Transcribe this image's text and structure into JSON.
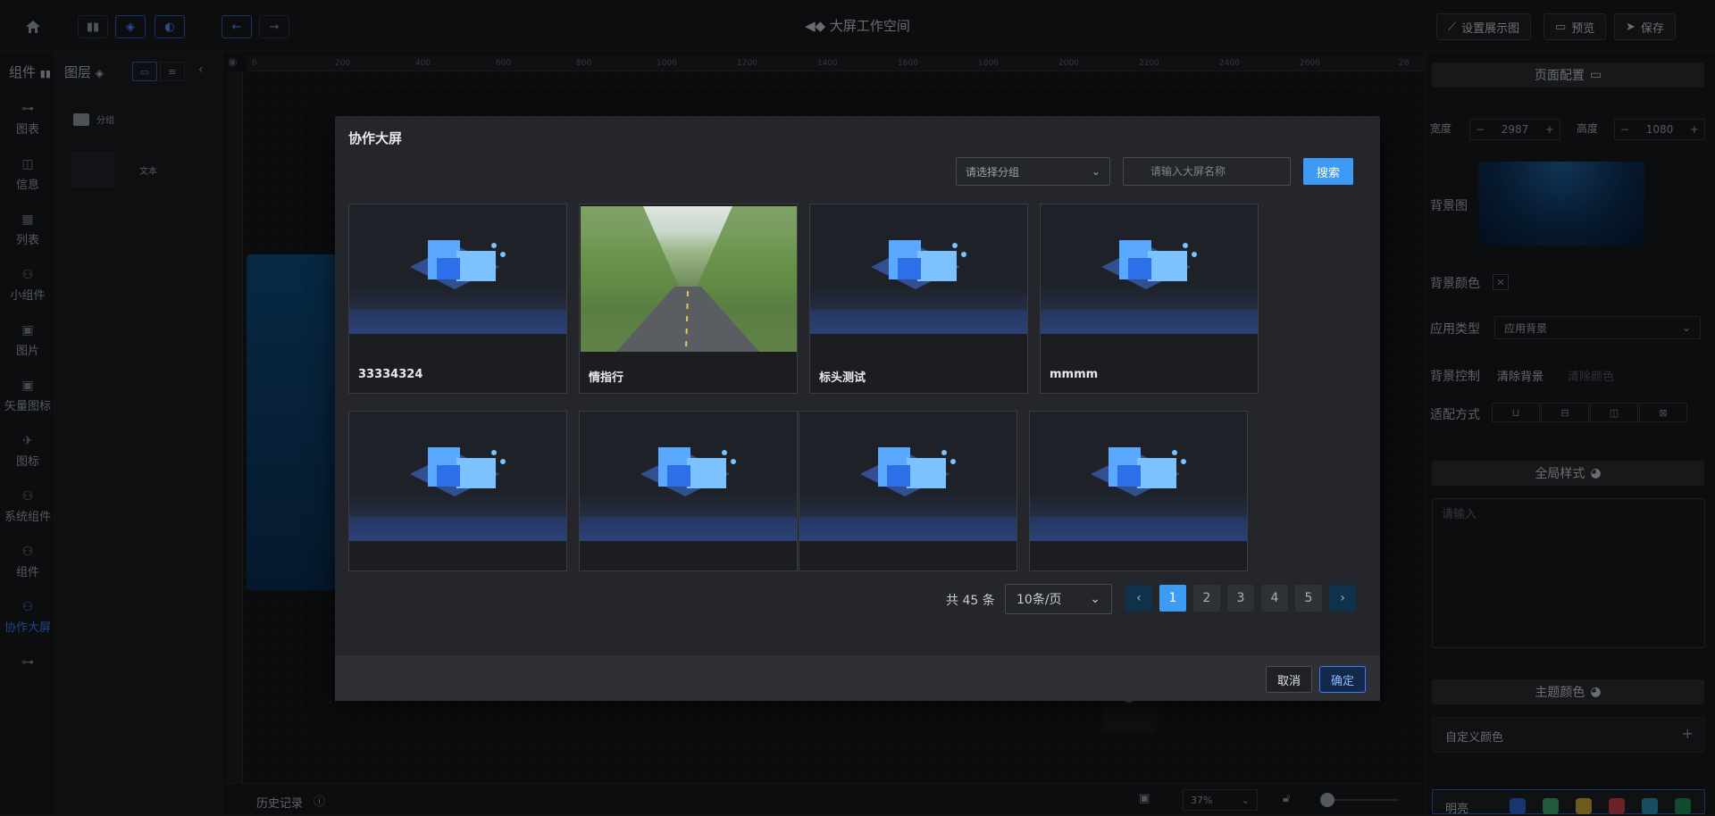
{
  "topbar": {
    "title": "大屏工作空间",
    "right_buttons": [
      "设置展示图",
      "预览",
      "保存"
    ]
  },
  "leftnav": {
    "header": "组件",
    "items": [
      {
        "label": "图表",
        "icon": "chart-icon"
      },
      {
        "label": "信息",
        "icon": "info-icon"
      },
      {
        "label": "列表",
        "icon": "table-icon"
      },
      {
        "label": "小组件",
        "icon": "widget-icon"
      },
      {
        "label": "图片",
        "icon": "image-icon"
      },
      {
        "label": "矢量图标",
        "icon": "vector-icon"
      },
      {
        "label": "图标",
        "icon": "plane-icon"
      },
      {
        "label": "系统组件",
        "icon": "system-icon"
      },
      {
        "label": "组件",
        "icon": "component-icon"
      },
      {
        "label": "协作大屏",
        "icon": "collab-icon",
        "active": true
      }
    ]
  },
  "layers": {
    "header": "图层",
    "items": [
      {
        "label": "分组"
      },
      {
        "label": "文本"
      }
    ]
  },
  "ruler": {
    "ticks": [
      "0",
      "200",
      "400",
      "600",
      "800",
      "1000",
      "1200",
      "1400",
      "1600",
      "1800",
      "2000",
      "2200",
      "2400",
      "2600",
      "28"
    ]
  },
  "rpanel": {
    "page_config": "页面配置",
    "width_label": "宽度",
    "width_value": "2987",
    "height_label": "高度",
    "height_value": "1080",
    "bg_image_label": "背景图",
    "bg_color_label": "背景颜色",
    "app_type_label": "应用类型",
    "app_type_value": "应用背景",
    "bg_control_label": "背景控制",
    "clear_bg": "清除背景",
    "clear_color": "清除颜色",
    "fit_label": "适配方式",
    "global_style": "全局样式",
    "textarea_placeholder": "请输入",
    "theme_color": "主题颜色",
    "custom_color": "自定义颜色",
    "bright_label": "明亮",
    "swatches": [
      "#2d63c8",
      "#3fa26a",
      "#c9a43a",
      "#c2414b",
      "#2a8fb0",
      "#1f8a5a"
    ]
  },
  "bottombar": {
    "history": "历史记录",
    "zoom": "37%"
  },
  "modal": {
    "title": "协作大屏",
    "group_placeholder": "请选择分组",
    "name_placeholder": "请输入大屏名称",
    "search_label": "搜索",
    "cards": [
      {
        "name": "33334324"
      },
      {
        "name": "情指行"
      },
      {
        "name": "标头测试"
      },
      {
        "name": "mmmm"
      },
      {
        "name": ""
      },
      {
        "name": ""
      },
      {
        "name": ""
      },
      {
        "name": ""
      }
    ],
    "total": "共 45 条",
    "page_size": "10条/页",
    "pages": [
      "1",
      "2",
      "3",
      "4",
      "5"
    ],
    "current_page": 1,
    "cancel_label": "取消",
    "confirm_label": "确定"
  }
}
